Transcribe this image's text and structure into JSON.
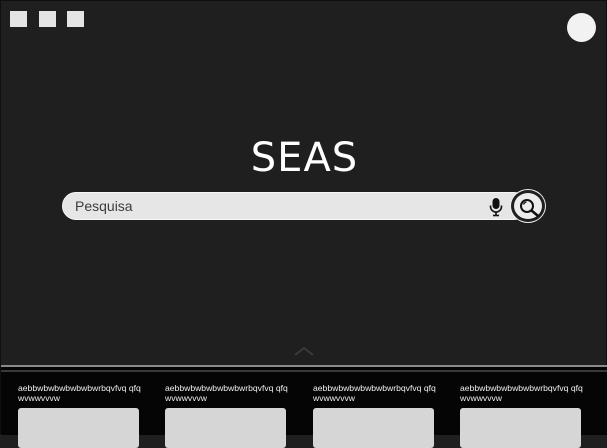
{
  "header": {
    "window_icons": [
      "square-icon",
      "square-icon",
      "square-icon"
    ],
    "avatar": "avatar-icon"
  },
  "logo": {
    "text": "SEAS"
  },
  "search": {
    "placeholder": "Pesquisa",
    "value": "",
    "mic_icon": "microphone-icon",
    "button_icon": "search-icon"
  },
  "expand": {
    "icon": "chevron-up-icon"
  },
  "cards": [
    {
      "text": "aebbwbwbwbwbwbwrbqvfvq qfqwvwwvvvw"
    },
    {
      "text": "aebbwbwbwbwbwbwrbqvfvq qfqwvwwvvvw"
    },
    {
      "text": "aebbwbwbwbwbwbwrbqvfvq qfqwvwwvvvw"
    },
    {
      "text": "aebbwbwbwbwbwbwrbqvfvq qfqwvwwvvvw"
    }
  ],
  "colors": {
    "background": "#1f1f1f",
    "panel": "#050505",
    "search_bar": "#e6e6e6",
    "logo_text": "#ffffff"
  }
}
